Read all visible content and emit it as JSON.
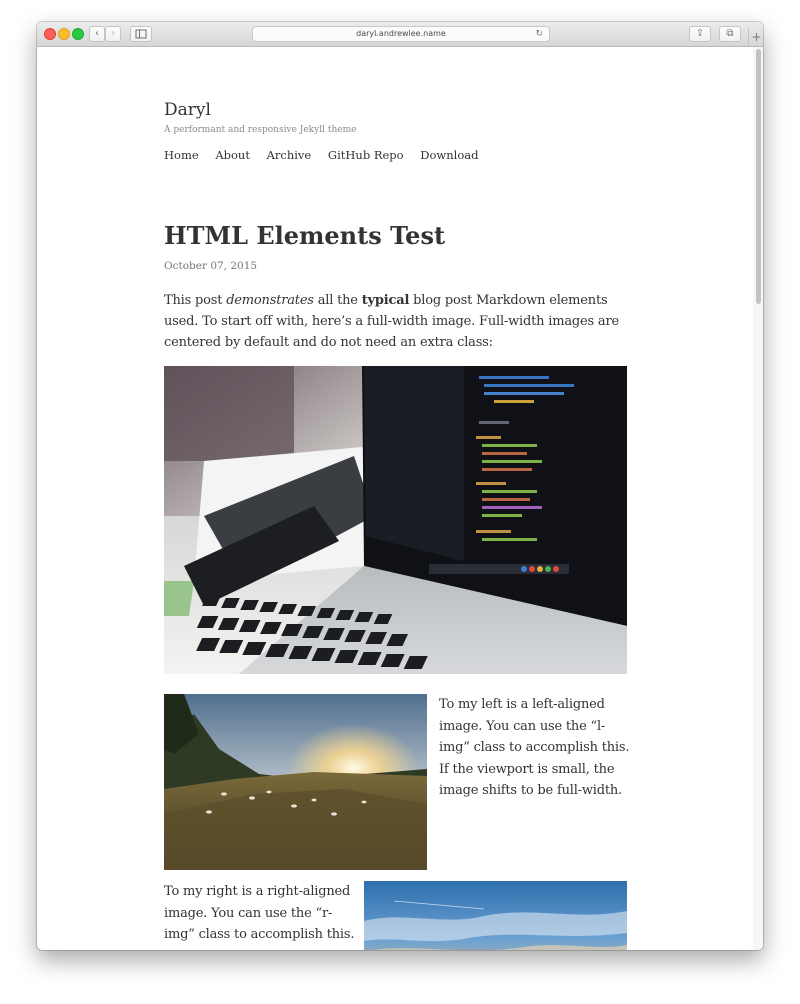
{
  "browser": {
    "url": "daryl.andrewlee.name",
    "back_icon": "‹",
    "forward_icon": "›",
    "reload_icon": "↻",
    "share_icon": "⇪",
    "tabs_icon": "⧉",
    "new_tab_icon": "+"
  },
  "site": {
    "title": "Daryl",
    "description": "A performant and responsive Jekyll theme",
    "nav": [
      "Home",
      "About",
      "Archive",
      "GitHub Repo",
      "Download"
    ]
  },
  "post": {
    "title": "HTML Elements Test",
    "date": "October 07, 2015",
    "intro": {
      "part1": "This post ",
      "em": "demonstrates",
      "part2": " all the ",
      "strong": "typical",
      "part3": " blog post Markdown elements used. To start off with, here’s a full-width image. Full-width images are centered by default and do not need an extra class:"
    },
    "left_image_text": "To my left is a left-aligned image. You can use the “l-img” class to accomplish this. If the viewport is small, the image shifts to be full-width.",
    "right_image_text": "To my right is a right-aligned image. You can use the “r-img” class to accomplish this. Like the left-aligned image, if the viewport is small, the"
  },
  "colors": {
    "text": "#333333",
    "muted": "#777777",
    "close": "#fc5f57",
    "minimize": "#fdbc2e",
    "maximize": "#28c840"
  }
}
